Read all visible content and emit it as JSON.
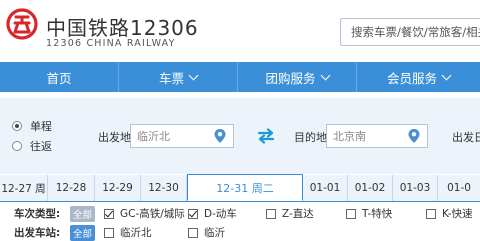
{
  "header": {
    "title_cn": "中国铁路12306",
    "title_en": "12306 CHINA RAILWAY",
    "search_placeholder": "搜索车票/餐饮/常旅客/相关规章"
  },
  "colors": {
    "brand_red": "#d7262c",
    "nav_blue": "#3b8fd9",
    "panel_bg": "#edf3fb"
  },
  "nav": [
    {
      "label": "首页",
      "has_dropdown": false
    },
    {
      "label": "车票",
      "has_dropdown": true
    },
    {
      "label": "团购服务",
      "has_dropdown": true
    },
    {
      "label": "会员服务",
      "has_dropdown": true
    }
  ],
  "trip_type": {
    "options": [
      "单程",
      "往返"
    ],
    "selected": "单程"
  },
  "from": {
    "label": "出发地",
    "value": "临沂北"
  },
  "to": {
    "label": "目的地",
    "value": "北京南"
  },
  "depart_date": {
    "label": "出发日"
  },
  "dates": [
    "12-27 周",
    "12-28",
    "12-29",
    "12-30",
    "12-31 周二",
    "01-01",
    "01-02",
    "01-03",
    "01-0"
  ],
  "active_date": "12-31 周二",
  "train_type": {
    "label": "车次类型:",
    "all_label": "全部",
    "options": [
      {
        "label": "GC-高铁/城际",
        "checked": true
      },
      {
        "label": "D-动车",
        "checked": true
      },
      {
        "label": "Z-直达",
        "checked": false
      },
      {
        "label": "T-特快",
        "checked": false
      },
      {
        "label": "K-快速",
        "checked": false
      }
    ]
  },
  "depart_station": {
    "label": "出发车站:",
    "all_label": "全部",
    "options": [
      {
        "label": "临沂北",
        "checked": false
      },
      {
        "label": "临沂",
        "checked": false
      }
    ]
  }
}
